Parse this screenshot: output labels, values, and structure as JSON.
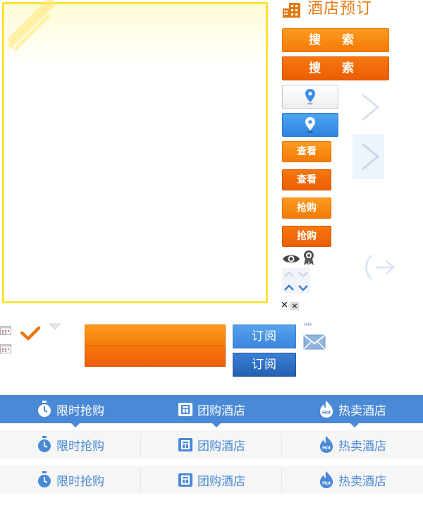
{
  "hotel": {
    "title": "酒店预订"
  },
  "buttons": {
    "search_1": "搜 索",
    "search_2": "搜 索",
    "view_1": "查看",
    "view_2": "查看",
    "grab_1": "抢购",
    "grab_2": "抢购",
    "subscribe_1": "订阅",
    "subscribe_2": "订阅"
  },
  "icons": {
    "quote": "❝❝",
    "close_small": "×"
  },
  "tabs": [
    {
      "label": "限时抢购",
      "icon": "clock-icon"
    },
    {
      "label": "团购酒店",
      "icon": "group-buy-icon"
    },
    {
      "label": "热卖酒店",
      "icon": "hot-flame-icon",
      "badge": "Hot"
    }
  ],
  "colors": {
    "accent_orange": "#f47b06",
    "accent_blue": "#4a89d6",
    "panel_border": "#fde13a"
  }
}
